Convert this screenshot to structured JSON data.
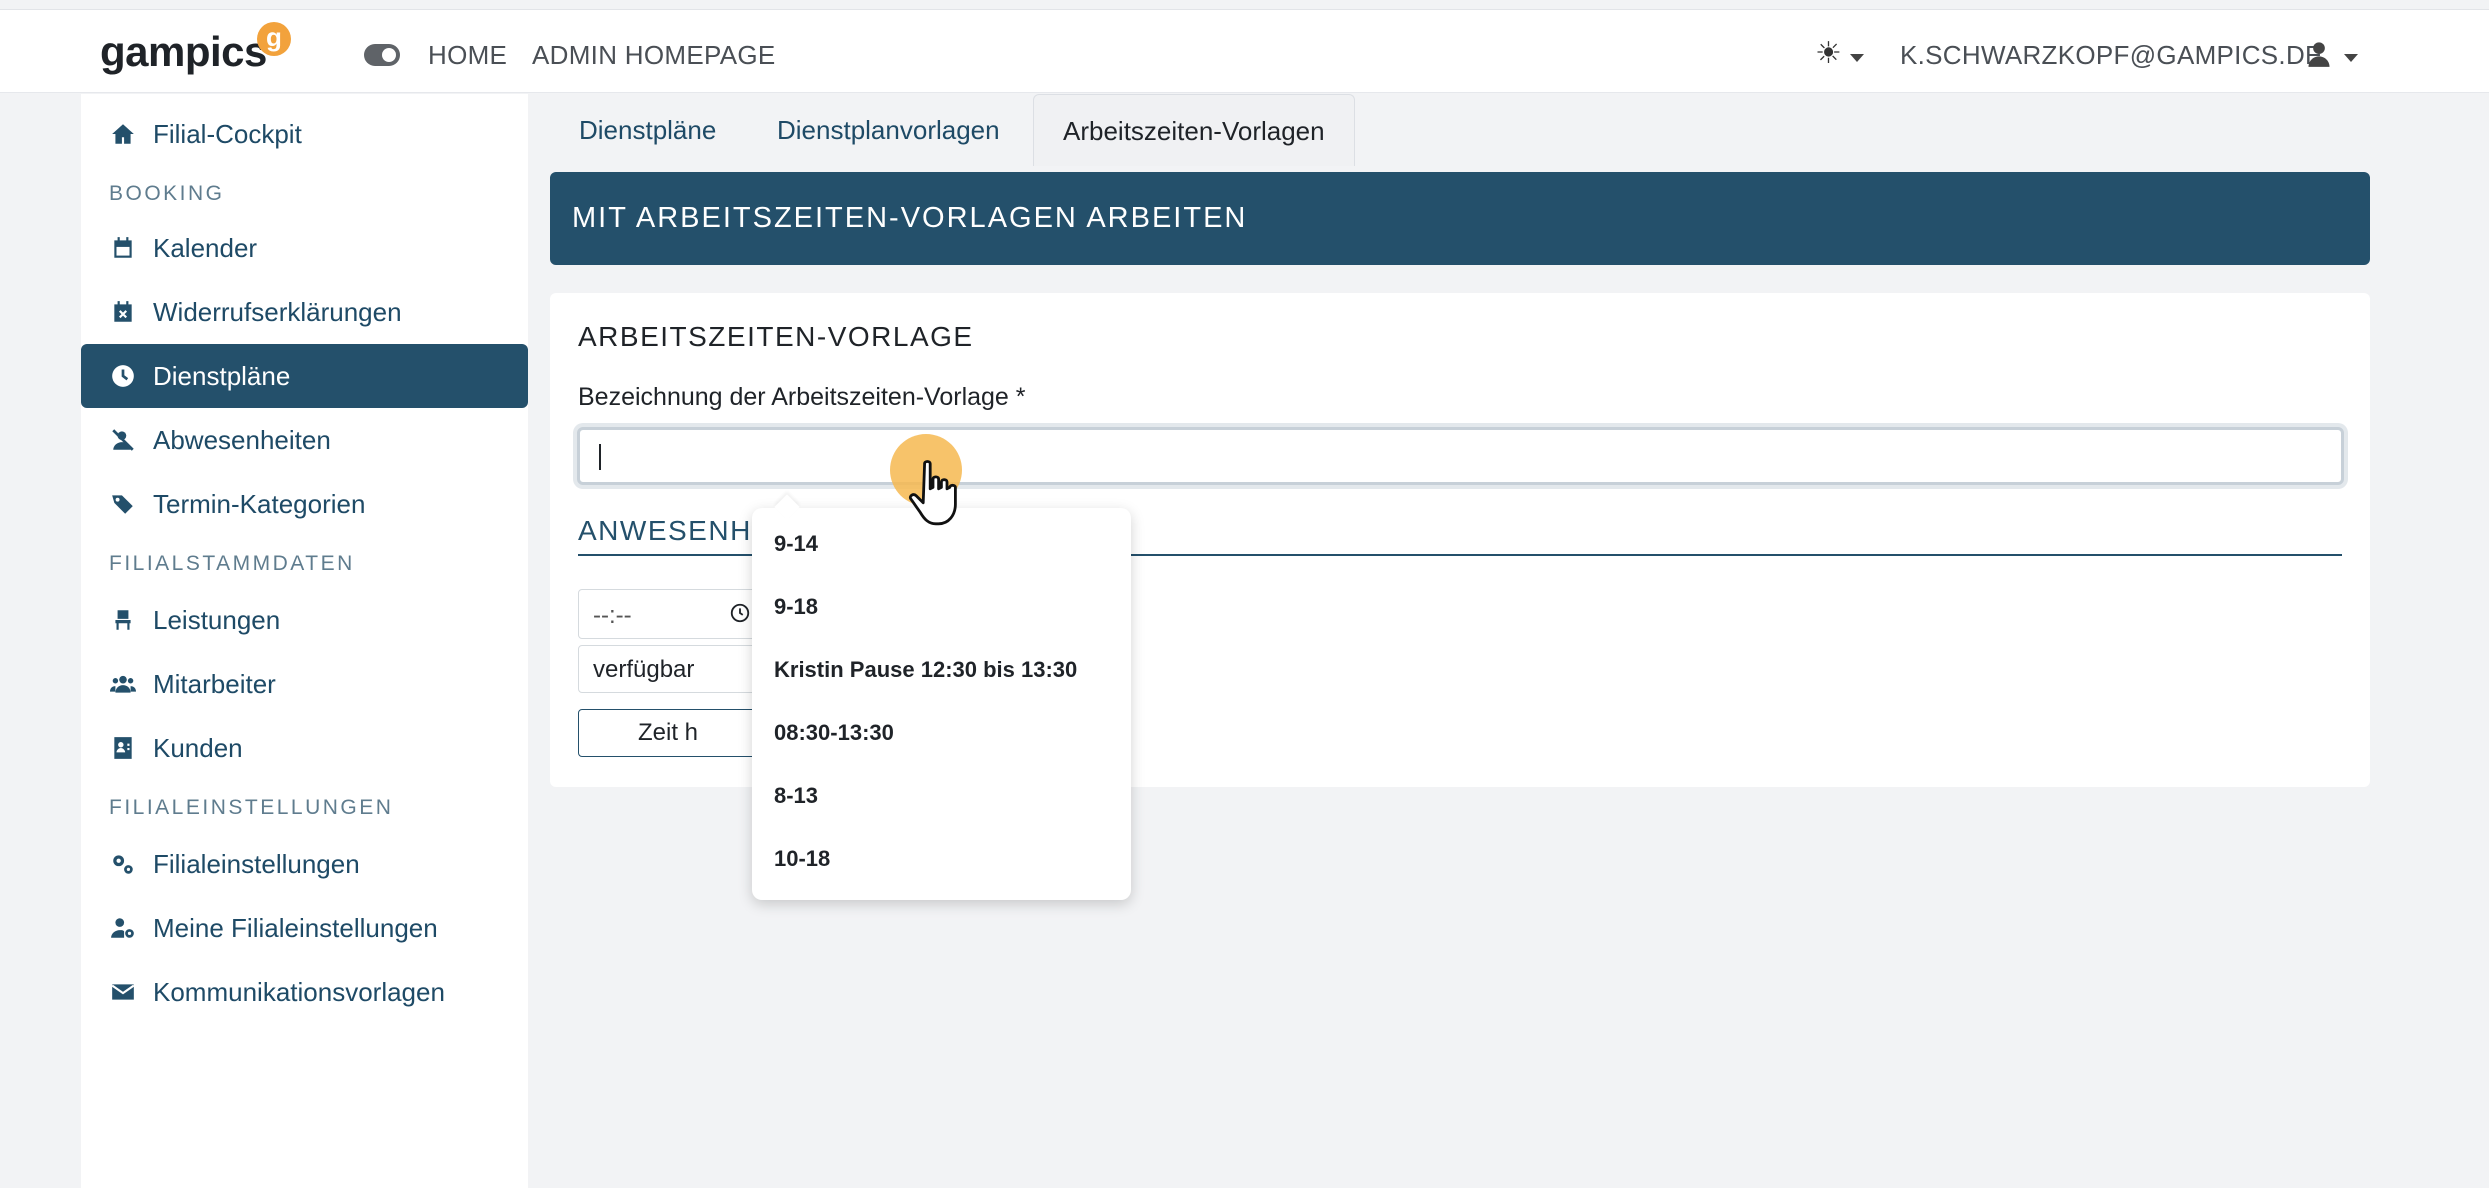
{
  "navbar": {
    "logo": "gampics",
    "logo_badge": "g",
    "links": {
      "home": "HOME",
      "admin": "ADMIN HOMEPAGE"
    },
    "theme_icon": "sun-icon",
    "theme_glyph": "☀",
    "user_email": "K.SCHWARZKOPF@GAMPICS.DE",
    "user_icon": "user-icon"
  },
  "sidebar": {
    "items": [
      {
        "label": "Filial-Cockpit",
        "icon": "home-icon"
      },
      {
        "label": "Kalender",
        "icon": "calendar-icon"
      },
      {
        "label": "Widerrufserklärungen",
        "icon": "calendar-x-icon"
      },
      {
        "label": "Dienstpläne",
        "icon": "clock-icon",
        "active": true
      },
      {
        "label": "Abwesenheiten",
        "icon": "user-slash-icon"
      },
      {
        "label": "Termin-Kategorien",
        "icon": "tags-icon"
      },
      {
        "label": "Leistungen",
        "icon": "chair-icon"
      },
      {
        "label": "Mitarbeiter",
        "icon": "users-icon"
      },
      {
        "label": "Kunden",
        "icon": "contact-card-icon"
      },
      {
        "label": "Filialeinstellungen",
        "icon": "gears-icon"
      },
      {
        "label": "Meine Filialeinstellungen",
        "icon": "user-gear-icon"
      },
      {
        "label": "Kommunikationsvorlagen",
        "icon": "envelope-icon"
      }
    ],
    "headings": {
      "booking": "BOOKING",
      "stammdaten": "FILIALSTAMMDATEN",
      "einstellungen": "FILIALEINSTELLUNGEN"
    }
  },
  "tabs": [
    {
      "label": "Dienstpläne"
    },
    {
      "label": "Dienstplanvorlagen"
    },
    {
      "label": "Arbeitszeiten-Vorlagen",
      "active": true
    }
  ],
  "banner": {
    "title": "MIT ARBEITSZEITEN-VORLAGEN ARBEITEN"
  },
  "form": {
    "card_title": "ARBEITSZEITEN-VORLAGE",
    "name_label": "Bezeichnung der Arbeitszeiten-Vorlage *",
    "name_value": "",
    "section_title": "ANWESENHE",
    "time_placeholder": "--:--",
    "availability_value": "verfügbar",
    "add_button": "Zeit h"
  },
  "dropdown": {
    "options": [
      "9-14",
      "9-18",
      "Kristin Pause 12:30 bis 13:30",
      "08:30-13:30",
      "8-13",
      "10-18"
    ]
  },
  "colors": {
    "primary": "#24506b",
    "accent": "#f2a23c",
    "background": "#f2f3f5"
  }
}
